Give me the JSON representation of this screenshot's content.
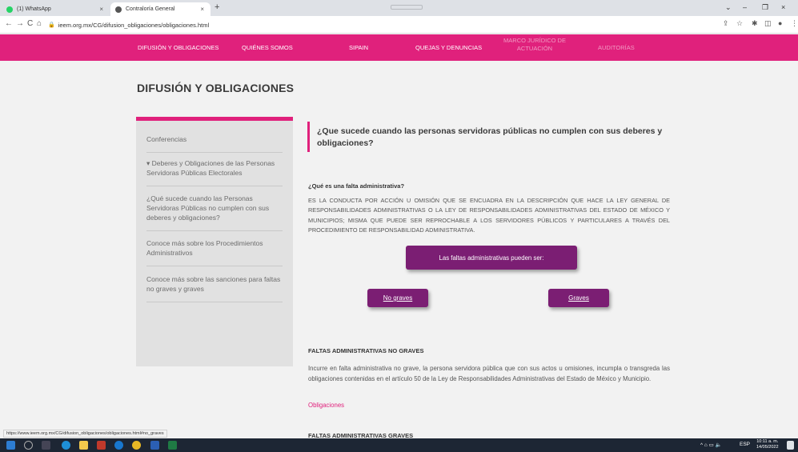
{
  "browser": {
    "tabs": [
      {
        "label": "(1) WhatsApp",
        "close": "×"
      },
      {
        "label": "Contraloría General",
        "close": "×"
      }
    ],
    "new_tab": "+",
    "window_controls": [
      "⌄",
      "–",
      "❐",
      "×"
    ],
    "nav": {
      "back": "←",
      "forward": "→",
      "reload": "C",
      "home": "⌂"
    },
    "url": "ieem.org.mx/CG/difusion_obligaciones/obligaciones.html",
    "toolbar_icons": [
      "share-icon",
      "star-icon",
      "extension-icon",
      "sidebar-icon",
      "profile-icon",
      "menu-icon"
    ],
    "toolbar_glyphs": [
      "⇪",
      "☆",
      "✱",
      "◫",
      "●",
      "⋮"
    ]
  },
  "site_nav": {
    "items": [
      "DIFUSIÓN Y OBLIGACIONES",
      "QUIÉNES SOMOS",
      "SIPAIN",
      "QUEJAS Y DENUNCIAS",
      "MARCO JURÍDICO DE ACTUACIÓN",
      "AUDITORÍAS"
    ]
  },
  "page_title": "DIFUSIÓN Y OBLIGACIONES",
  "sidebar": {
    "items": [
      "Conferencias",
      "▾ Deberes y Obligaciones de las Personas Servidoras Públicas Electorales",
      "¿Qué sucede cuando las Personas Servidoras Públicas no cumplen con sus deberes y obligaciones?",
      "Conoce más sobre los Procedimientos Administrativos",
      "Conoce más sobre las sanciones para faltas no graves y graves"
    ]
  },
  "main": {
    "question": "¿Que sucede cuando las personas servidoras públicas no cumplen con sus deberes y obligaciones?",
    "subheading": "¿Qué es una falta administrativa?",
    "definition": "ES LA CONDUCTA POR ACCIÓN U OMISIÓN QUE SE ENCUADRA EN LA DESCRIPCIÓN QUE HACE LA LEY GENERAL DE RESPONSABILIDADES ADMINISTRATIVAS O LA LEY DE RESPONSABILIDADES ADMINISTRATIVAS DEL ESTADO DE MÉXICO Y MUNICIPIOS; MISMA QUE PUEDE SER REPROCHABLE A LOS SERVIDORES PÚBLICOS Y PARTICULARES A TRAVÉS DEL PROCEDIMIENTO DE RESPONSABILIDAD ADMINISTRATIVA.",
    "faltas_box": "Las faltas administrativas pueden ser:",
    "btn_no_graves": "No graves",
    "btn_graves": "Graves",
    "section_no_graves": "FALTAS ADMINISTRATIVAS NO GRAVES",
    "no_graves_text": "Incurre en falta administrativa no grave, la persona servidora pública que con sus actos u omisiones, incumpla o transgreda las obligaciones contenidas en el artículo 50 de la Ley de Responsabilidades Administrativas del Estado de México y Municipio.",
    "obligaciones_link": "Obligaciones",
    "section_graves": "FALTAS ADMINISTRATIVAS GRAVES"
  },
  "status_url": "https://www.ieem.org.mx/CG/difusion_obligaciones/obligaciones.html#no_graves",
  "taskbar": {
    "tray_text": "ESP",
    "tray_glyphs": "^ ⌂ ▭ 🔈",
    "time": "10:11 a. m.",
    "date": "14/05/2022"
  },
  "colors": {
    "brand_pink": "#e0217c",
    "button_purple": "#7b1e73"
  }
}
